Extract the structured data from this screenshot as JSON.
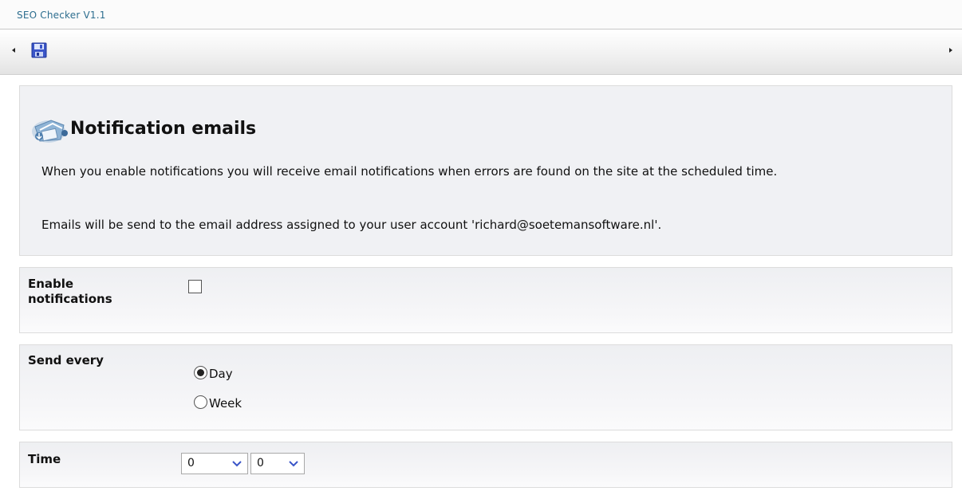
{
  "app": {
    "title": "SEO Checker V1.1"
  },
  "toolbar": {
    "save_icon": "floppy-disk-icon"
  },
  "intro": {
    "heading": "Notification emails",
    "icon": "email-notification-icon",
    "paragraph1": "When you enable notifications you will receive email notifications when errors are found on the site at the scheduled time.",
    "paragraph2": "Emails will be send to the email address assigned to your user account 'richard@soetemansoftware.nl'."
  },
  "enable": {
    "label_line1": "Enable",
    "label_line2": "notifications",
    "checked": false
  },
  "send_every": {
    "label": "Send every",
    "options": [
      {
        "label": "Day",
        "selected": true
      },
      {
        "label": "Week",
        "selected": false
      }
    ]
  },
  "time": {
    "label": "Time",
    "hour": "0",
    "minute": "0",
    "separator": ":"
  },
  "colors": {
    "title_text": "#2d6e8f",
    "panel_bg": "#f0f1f4",
    "save_icon": "#3a55c8"
  }
}
